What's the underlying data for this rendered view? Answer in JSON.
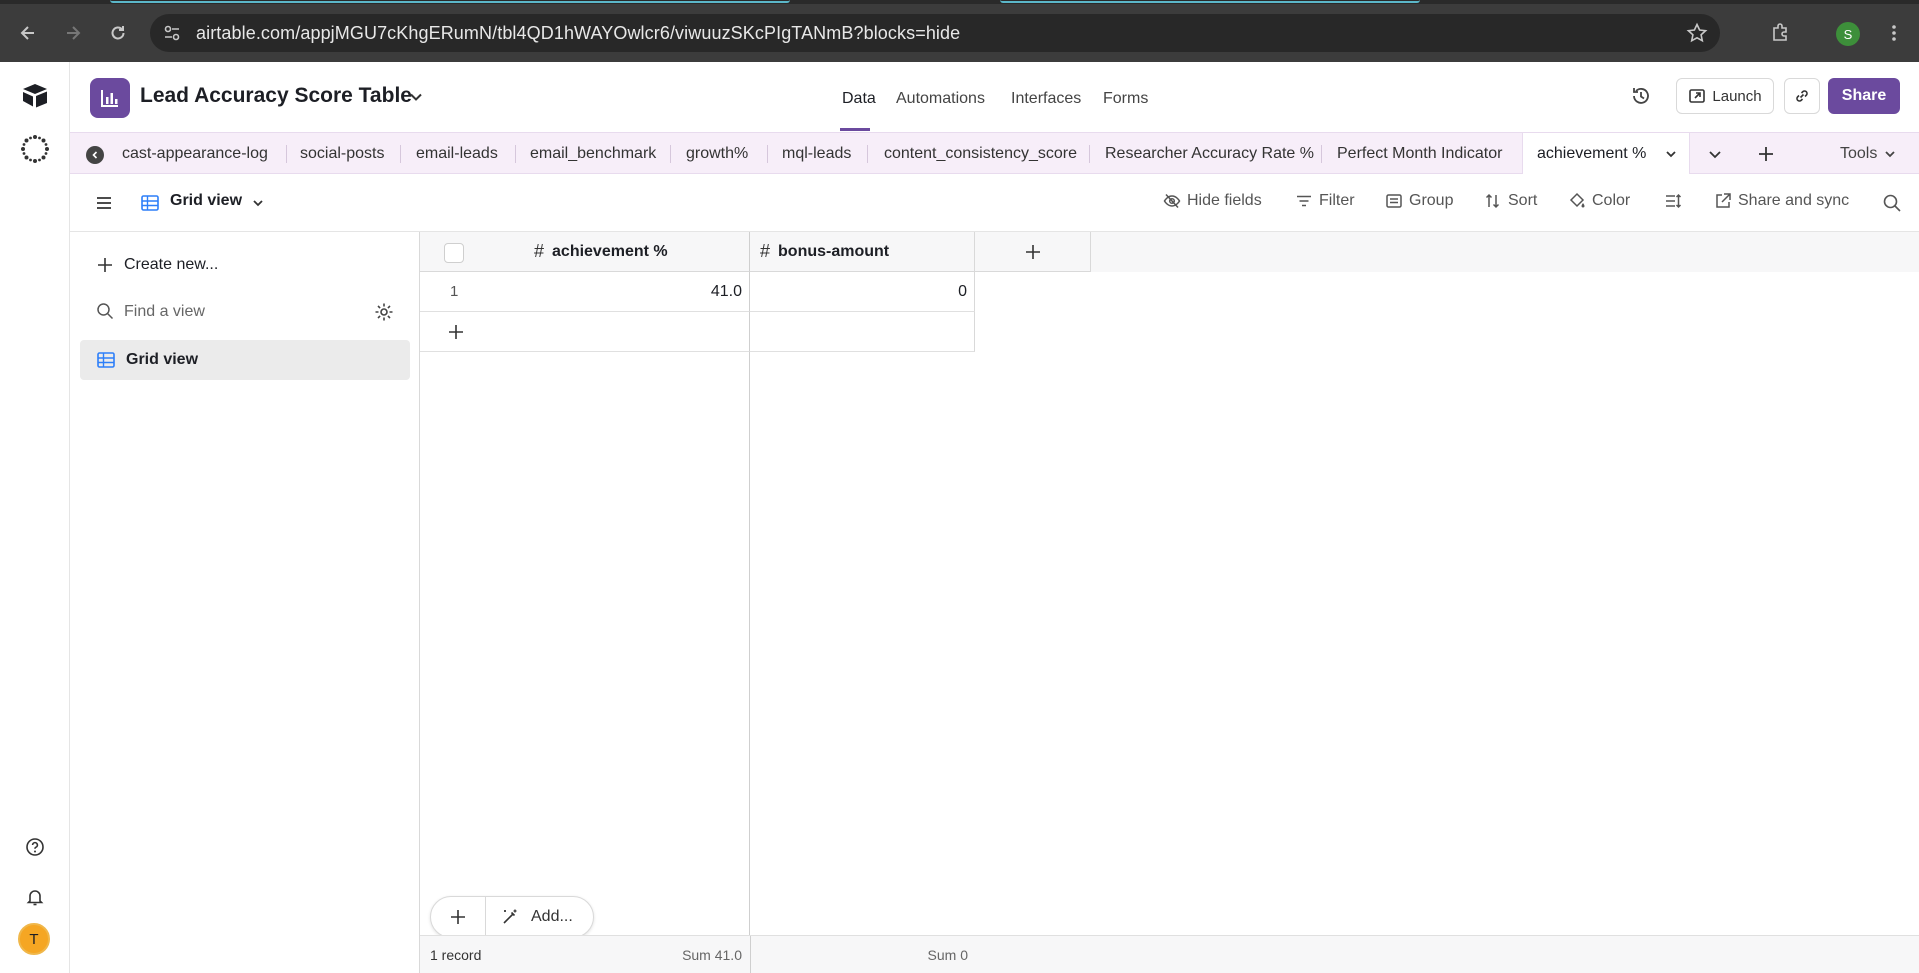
{
  "browser": {
    "url": "airtable.com/appjMGU7cKhgERumN/tbl4QD1hWAYOwlcr6/viwuuzSKcPIgTANmB?blocks=hide",
    "profile_initial": "S"
  },
  "rail": {
    "avatar_initial": "T"
  },
  "header": {
    "base_title": "Lead Accuracy Score Table",
    "nav": [
      "Data",
      "Automations",
      "Interfaces",
      "Forms"
    ],
    "active_nav": "Data",
    "launch_label": "Launch",
    "share_label": "Share",
    "accent_color": "#6b4a9e"
  },
  "tables": {
    "items": [
      "cast-appearance-log",
      "social-posts",
      "email-leads",
      "email_benchmark",
      "growth%",
      "mql-leads",
      "content_consistency_score",
      "Researcher Accuracy Rate %",
      "Perfect Month Indicator"
    ],
    "active": "achievement %",
    "tools_label": "Tools"
  },
  "toolbar": {
    "view_name": "Grid view",
    "hide_fields": "Hide fields",
    "filter": "Filter",
    "group": "Group",
    "sort": "Sort",
    "color": "Color",
    "share_sync": "Share and sync"
  },
  "sidebar": {
    "create_label": "Create new...",
    "find_placeholder": "Find a view",
    "views": [
      {
        "label": "Grid view"
      }
    ]
  },
  "grid": {
    "columns": [
      "achievement %",
      "bonus-amount"
    ],
    "rows": [
      {
        "num": "1",
        "achievement": "41.0",
        "bonus": "0"
      }
    ],
    "add_label": "Add...",
    "record_count": "1 record",
    "sum_achievement": "Sum 41.0",
    "sum_bonus": "Sum 0"
  }
}
